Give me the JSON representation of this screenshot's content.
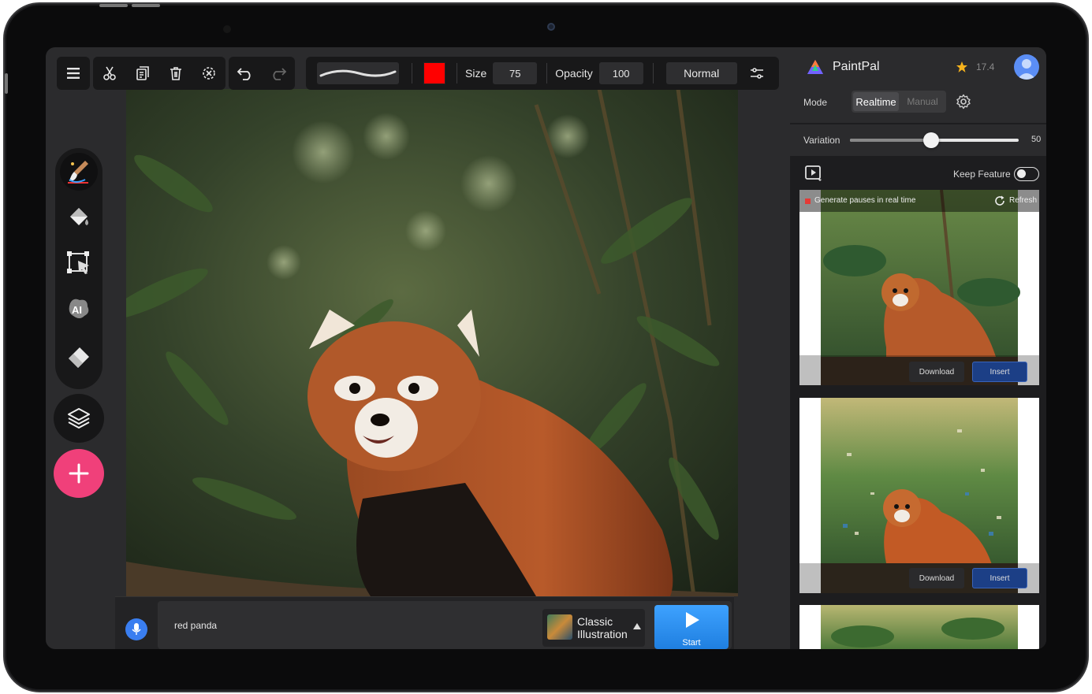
{
  "toolbar": {
    "size_label": "Size",
    "size_value": "75",
    "opacity_label": "Opacity",
    "opacity_value": "100",
    "blend_mode": "Normal",
    "brush_color": "#ff0000"
  },
  "panel": {
    "app_name": "PaintPal",
    "credits": "17.4",
    "mode_label": "Mode",
    "mode_realtime": "Realtime",
    "mode_manual": "Manual",
    "variation_label": "Variation",
    "variation_value": "50",
    "variation_fraction": 0.48,
    "keep_feature_label": "Keep Feature",
    "keep_feature_on": false
  },
  "results": {
    "status_text": "Generate pauses in real time",
    "refresh_label": "Refresh",
    "download_label": "Download",
    "insert_label": "Insert"
  },
  "prompt": {
    "text": "red panda",
    "style_line1": "Classic",
    "style_line2": "Illustration",
    "start_label": "Start"
  },
  "colors": {
    "accent_pink": "#f0407a",
    "start_blue": "#2d93f5",
    "insert_blue": "#1c3f86",
    "mic_blue": "#3a7ef0"
  }
}
